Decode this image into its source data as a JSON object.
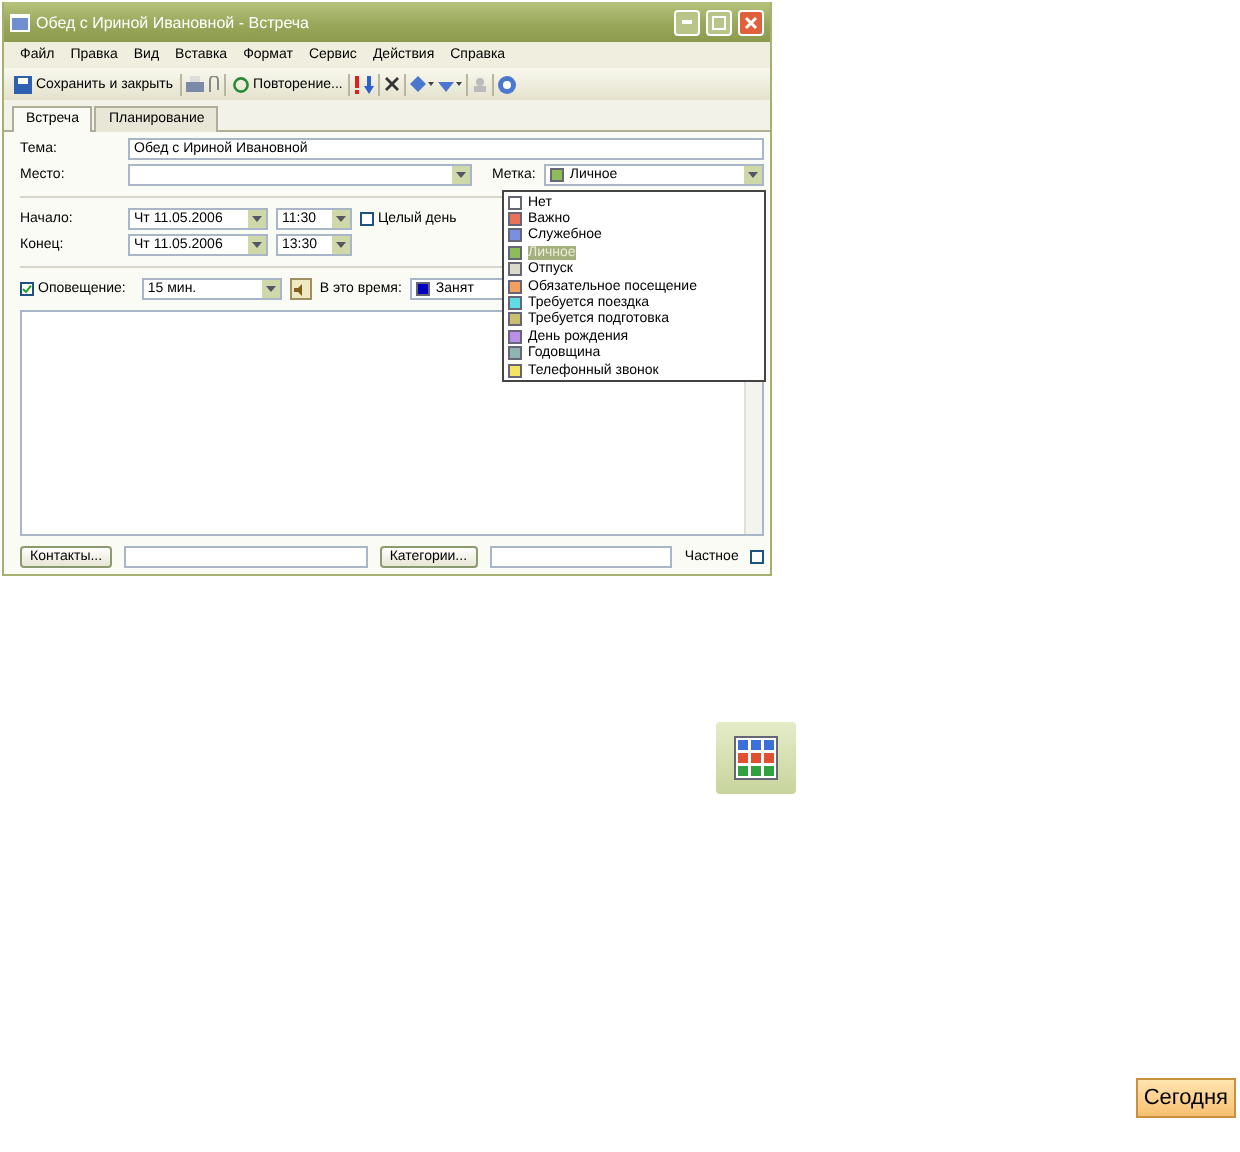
{
  "window": {
    "title": "Обед с Ириной Ивановной - Встреча"
  },
  "menu": [
    "Файл",
    "Правка",
    "Вид",
    "Вставка",
    "Формат",
    "Сервис",
    "Действия",
    "Справка"
  ],
  "toolbar": {
    "save_label": "Сохранить и закрыть",
    "recurrence_label": "Повторение..."
  },
  "tabs": [
    {
      "label": "Встреча",
      "selected": true
    },
    {
      "label": "Планирование",
      "selected": false
    }
  ],
  "form": {
    "subject_label": "Тема:",
    "subject_value": "Обед с Ириной Ивановной",
    "location_label": "Место:",
    "tag_label": "Метка:",
    "tag": {
      "value": "Личное",
      "color": "#8fbc5a"
    },
    "start_label": "Начало:",
    "start_date": "Чт 11.05.2006",
    "start_time": "11:30",
    "all_day_label": "Целый день",
    "all_day_checked": false,
    "end_label": "Конец:",
    "end_date": "Чт 11.05.2006",
    "end_time": "13:30",
    "reminder_label": "Оповещение:",
    "reminder_checked": true,
    "reminder_value": "15 мин.",
    "show_as_label": "В это время:",
    "show_as": {
      "value": "Занят",
      "color": "#0000c0"
    }
  },
  "tag_options": [
    {
      "name": "Нет",
      "color": "#ffffff",
      "selected": false
    },
    {
      "name": "Важно",
      "color": "#e8735a",
      "selected": false
    },
    {
      "name": "Служебное",
      "color": "#7b8fe0",
      "selected": false
    },
    {
      "name": "Личное",
      "color": "#8fbc5a",
      "selected": true
    },
    {
      "name": "Отпуск",
      "color": "#dcd8cc",
      "selected": false
    },
    {
      "name": "Обязательное посещение",
      "color": "#f0a060",
      "selected": false
    },
    {
      "name": "Требуется поездка",
      "color": "#60dce4",
      "selected": false
    },
    {
      "name": "Требуется подготовка",
      "color": "#c8c070",
      "selected": false
    },
    {
      "name": "День рождения",
      "color": "#b890e8",
      "selected": false
    },
    {
      "name": "Годовщина",
      "color": "#90b4b0",
      "selected": false
    },
    {
      "name": "Телефонный звонок",
      "color": "#f4e464",
      "selected": false
    }
  ],
  "bottom": {
    "contacts_button": "Контакты...",
    "categories_button": "Категории...",
    "private_label": "Частное",
    "private_checked": false
  },
  "today_button": "Сегодня"
}
